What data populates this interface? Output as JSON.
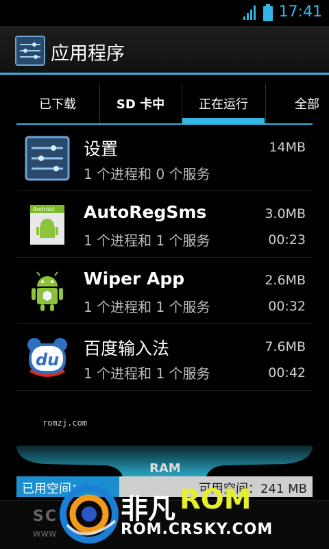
{
  "status": {
    "time": "17:41"
  },
  "header": {
    "title": "应用程序"
  },
  "tabs": [
    {
      "label": "已下载"
    },
    {
      "label": "SD 卡中"
    },
    {
      "label": "正在运行"
    },
    {
      "label": "全部"
    }
  ],
  "apps": [
    {
      "name": "设置",
      "sub": "1 个进程和 0 个服务",
      "size": "14MB",
      "time": ""
    },
    {
      "name": "AutoRegSms",
      "sub": "1 个进程和 1 个服务",
      "size": "3.0MB",
      "time": "00:23"
    },
    {
      "name": "Wiper App",
      "sub": "1 个进程和 1 个服务",
      "size": "2.6MB",
      "time": "00:32"
    },
    {
      "name": "百度输入法",
      "sub": "1 个进程和 1 个服务",
      "size": "7.6MB",
      "time": "00:42"
    }
  ],
  "watermark": "romzj.com",
  "ram": {
    "label": "RAM",
    "used": "已用空间：",
    "free": "可用空间：241 MB"
  },
  "footer": {
    "left_main": "SC",
    "left_sub": "www"
  },
  "brand": {
    "main": "非凡",
    "rom": "ROM",
    "sub": "ROM.CRSKY.COM"
  },
  "colors": {
    "accent": "#33b5e5"
  }
}
